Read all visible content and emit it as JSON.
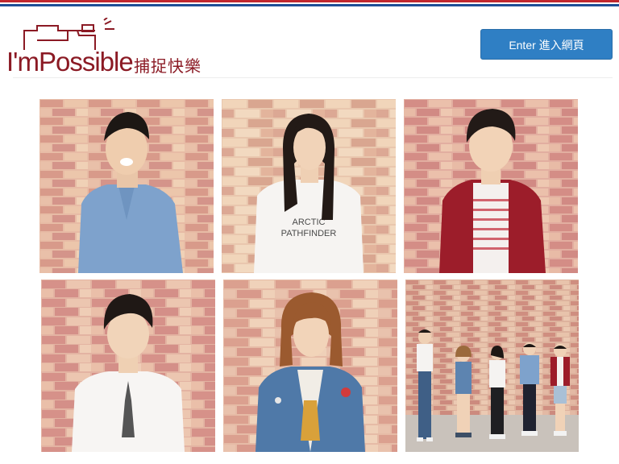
{
  "brand": {
    "name": "I'mPossible",
    "chinese": "捕捉快樂"
  },
  "header": {
    "enter_label": "Enter 進入網頁"
  },
  "colors": {
    "brand_red": "#8b1a24",
    "button_blue": "#2f7fc4",
    "stripe_red": "#c1272d",
    "stripe_blue": "#1f4e96"
  },
  "gallery": {
    "photos": [
      {
        "subject": "man-blue-shirt"
      },
      {
        "subject": "woman-white-tshirt"
      },
      {
        "subject": "man-red-cardigan"
      },
      {
        "subject": "man-white-tshirt"
      },
      {
        "subject": "woman-denim-jacket"
      },
      {
        "subject": "group-of-five"
      }
    ],
    "shirt_text_lines": [
      "ARCTIC",
      "PATHFINDER"
    ]
  }
}
